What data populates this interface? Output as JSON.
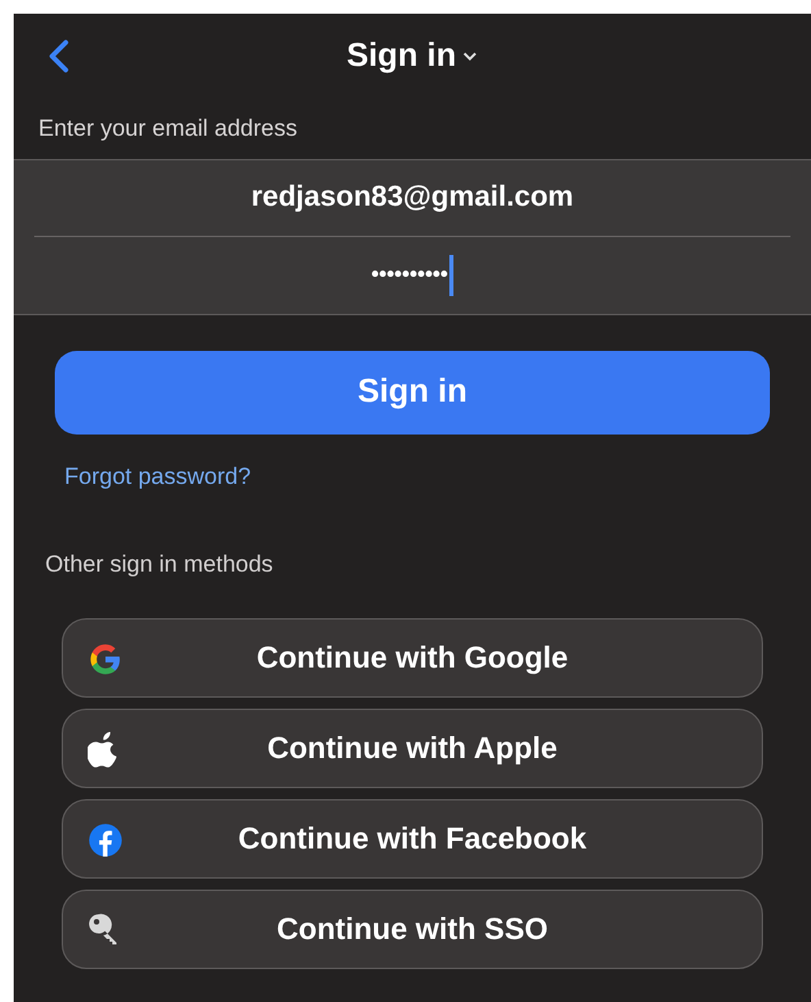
{
  "header": {
    "title": "Sign in"
  },
  "email_label": "Enter your email address",
  "email": {
    "value": "redjason83@gmail.com"
  },
  "password": {
    "value": "••••••••••",
    "focused": true
  },
  "sign_in_button": "Sign in",
  "forgot_link": "Forgot password?",
  "other_methods_label": "Other sign in methods",
  "providers": [
    {
      "kind": "google",
      "label": "Continue with Google"
    },
    {
      "kind": "apple",
      "label": "Continue with Apple"
    },
    {
      "kind": "facebook",
      "label": "Continue with Facebook"
    },
    {
      "kind": "key",
      "label": "Continue with SSO"
    }
  ]
}
